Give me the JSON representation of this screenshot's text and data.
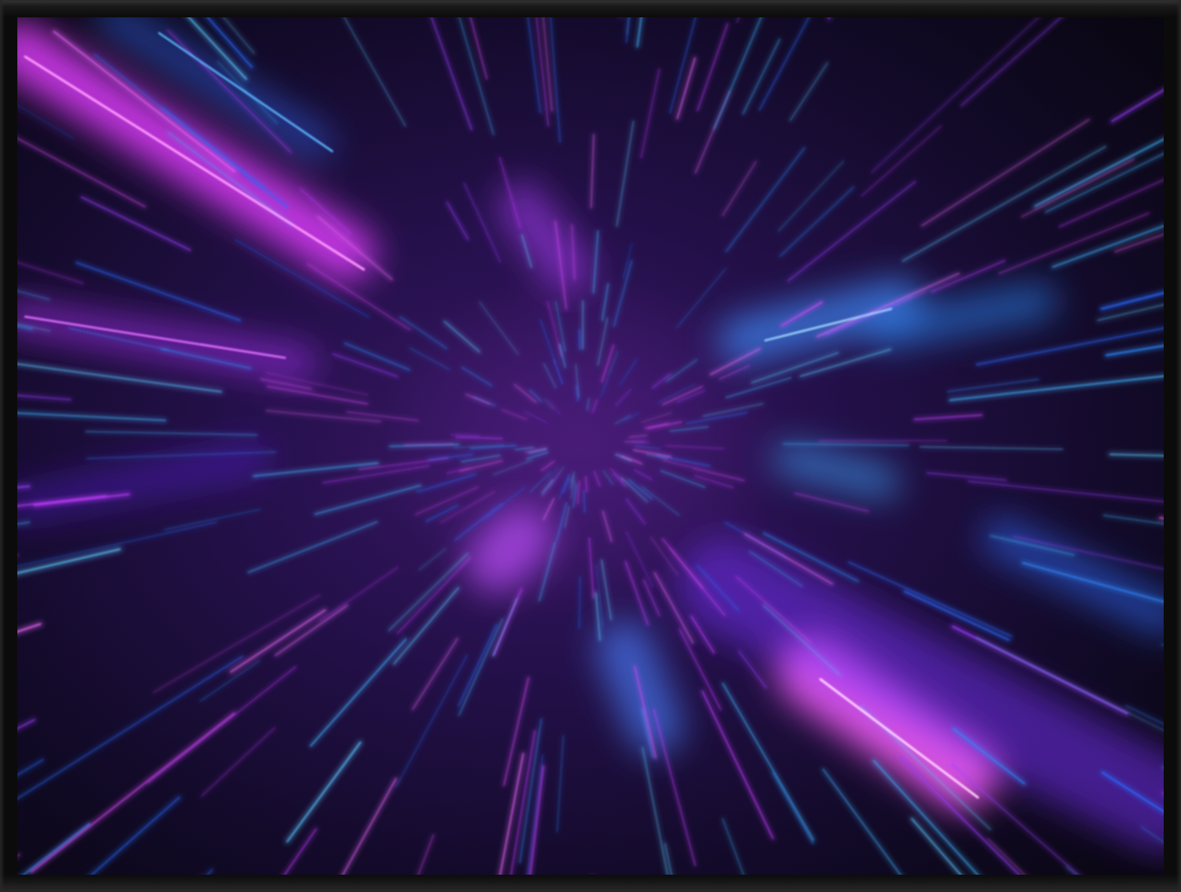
{
  "poster": {
    "framed": true
  }
}
